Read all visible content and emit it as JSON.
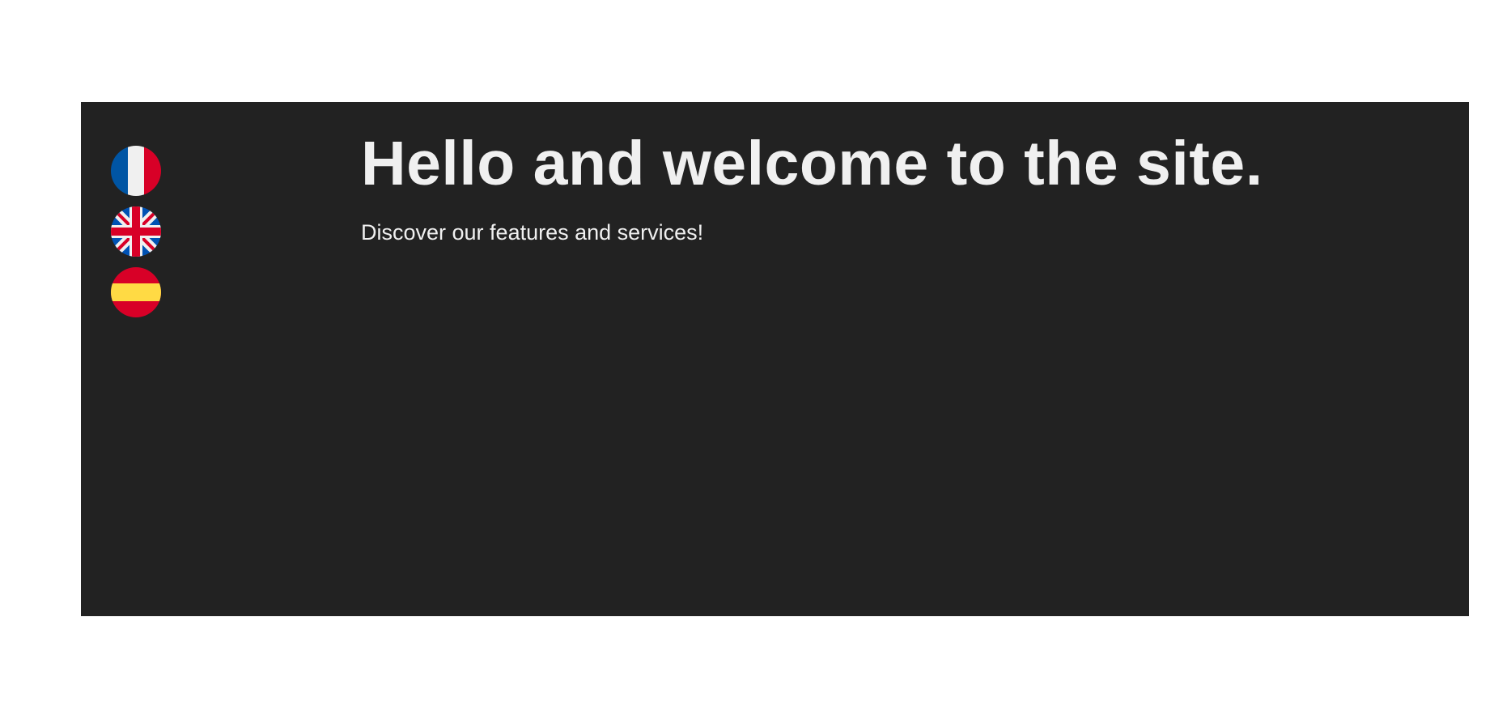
{
  "hero": {
    "headline": "Hello and welcome to the site.",
    "subtitle": "Discover our features and services!",
    "background_color": "#222222",
    "text_color": "#f0f0f0"
  },
  "language_switcher": {
    "flags": [
      {
        "icon": "france-flag-icon",
        "colors": [
          "#0055a4",
          "#f0f0f0",
          "#d80027"
        ]
      },
      {
        "icon": "united-kingdom-flag-icon",
        "colors": [
          "#0052b4",
          "#f0f0f0",
          "#d80027"
        ]
      },
      {
        "icon": "spain-flag-icon",
        "colors": [
          "#d80027",
          "#ffda44"
        ]
      }
    ]
  }
}
